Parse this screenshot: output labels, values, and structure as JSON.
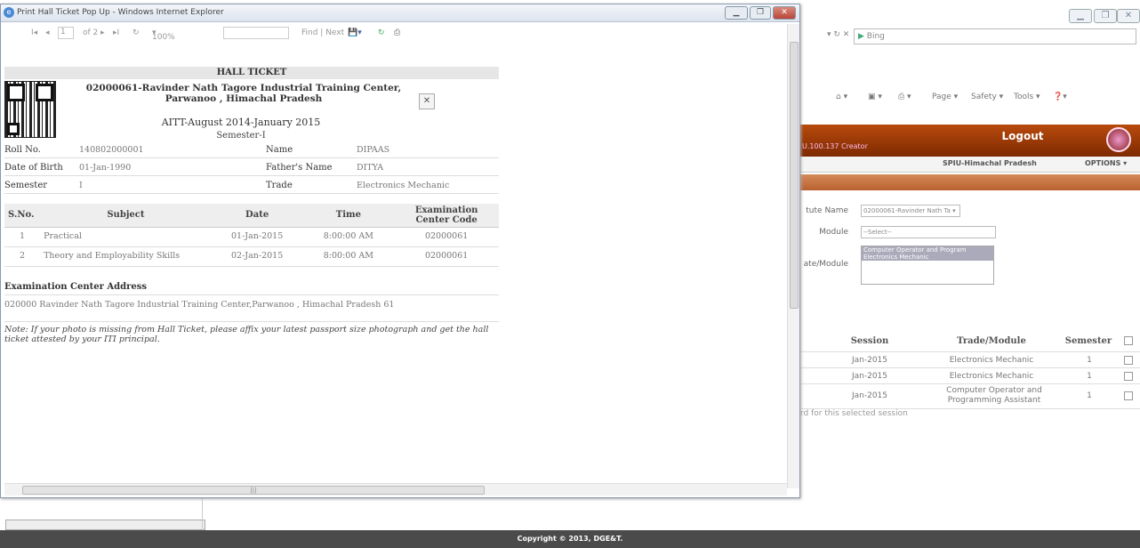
{
  "background_window": {
    "search_placeholder": "Bing",
    "command_bar": [
      "Page ▾",
      "Safety ▾",
      "Tools ▾"
    ],
    "header": {
      "logout_label": "Logout",
      "ip_text": "U.100.137 Creator"
    },
    "nav": {
      "state_label": "SPIU-Himachal Pradesh",
      "options_label": "OPTIONS ▾"
    },
    "form": {
      "institute_label": "tute Name",
      "institute_value": "02000061-Ravinder Nath Ta ▾",
      "module_label": "Module",
      "module_value": "--Select--",
      "trade_module_label": "ate/Module",
      "list_items": [
        "Computer Operator and Program",
        "Electronics Mechanic"
      ]
    },
    "table": {
      "headers": [
        "Session",
        "Trade/Module",
        "Semester"
      ],
      "rows": [
        {
          "session": "Jan-2015",
          "trade": "Electronics Mechanic",
          "semester": "1"
        },
        {
          "session": "Jan-2015",
          "trade": "Electronics Mechanic",
          "semester": "1"
        },
        {
          "session": "Jan-2015",
          "trade": "Computer Operator and Programming Assistant",
          "semester": "1"
        }
      ]
    },
    "no_data_text": "rd for this selected session",
    "footer": "Copyright © 2013, DGE&T."
  },
  "popup": {
    "title": "Print Hall Ticket Pop Up - Windows Internet Explorer",
    "toolbar": {
      "first": "I◂",
      "prev": "◂",
      "page": "1",
      "of_pages": "of 2",
      "next": "▸",
      "last": "▸I",
      "zoom": "100%",
      "find": "Find | Next"
    },
    "ticket": {
      "header": "HALL TICKET",
      "center_name": "02000061-Ravinder Nath Tagore Industrial Training Center, Parwanoo , Himachal Pradesh",
      "exam": "AITT-August 2014-January 2015",
      "semester_line": "Semester-I",
      "fields": {
        "roll_label": "Roll No.",
        "roll_value": "140802000001",
        "name_label": "Name",
        "name_value": "DIPAAS",
        "dob_label": "Date of Birth",
        "dob_value": "01-Jan-1990",
        "father_label": "Father's Name",
        "father_value": "DITYA",
        "sem_label": "Semester",
        "sem_value": "I",
        "trade_label": "Trade",
        "trade_value": "Electronics Mechanic"
      },
      "table_headers": [
        "S.No.",
        "Subject",
        "Date",
        "Time",
        "Examination Center Code"
      ],
      "rows": [
        {
          "sno": "1",
          "subject": "Practical",
          "date": "01-Jan-2015",
          "time": "8:00:00 AM",
          "code": "02000061"
        },
        {
          "sno": "2",
          "subject": "Theory and Employability Skills",
          "date": "02-Jan-2015",
          "time": "8:00:00 AM",
          "code": "02000061"
        }
      ],
      "address_title": "Examination Center Address",
      "address": "020000 Ravinder Nath Tagore Industrial Training Center,Parwanoo , Himachal Pradesh 61",
      "note": "Note: If your photo is missing from Hall Ticket, please affix your latest passport size photograph and get the hall ticket attested by your ITI principal."
    }
  }
}
